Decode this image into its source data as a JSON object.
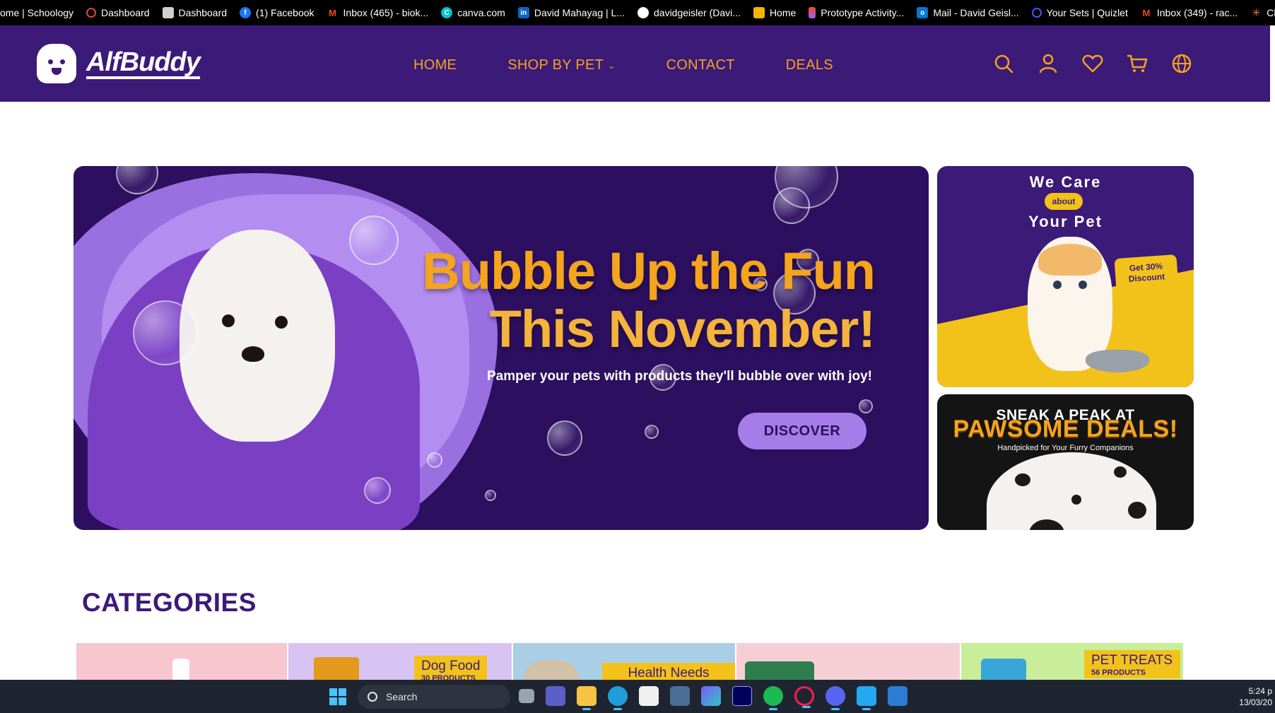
{
  "bookmarks": [
    {
      "label": "ome | Schoology",
      "icon": "schoology-icon",
      "color": "#000000"
    },
    {
      "label": "Dashboard",
      "icon": "dashboard-icon",
      "color": "#e0453a"
    },
    {
      "label": "Dashboard",
      "icon": "dashboard-icon",
      "color": "#d0d0d0"
    },
    {
      "label": "(1) Facebook",
      "icon": "facebook-icon",
      "color": "#1877f2"
    },
    {
      "label": "Inbox (465) - biok...",
      "icon": "gmail-icon",
      "color": "#ea4335"
    },
    {
      "label": "canva.com",
      "icon": "canva-icon",
      "color": "#00c4cc"
    },
    {
      "label": "David Mahayag | L...",
      "icon": "linkedin-icon",
      "color": "#0a66c2"
    },
    {
      "label": "davidgeisler (Davi...",
      "icon": "github-icon",
      "color": "#ffffff"
    },
    {
      "label": "Home",
      "icon": "home-icon",
      "color": "#f4b400"
    },
    {
      "label": "Prototype Activity...",
      "icon": "figma-icon",
      "color": "#f24e1e"
    },
    {
      "label": "Mail - David Geisl...",
      "icon": "outlook-icon",
      "color": "#0078d4"
    },
    {
      "label": "Your Sets | Quizlet",
      "icon": "quizlet-icon",
      "color": "#4255ff"
    },
    {
      "label": "Inbox (349) - rac...",
      "icon": "gmail-icon",
      "color": "#ea4335"
    },
    {
      "label": "Claude",
      "icon": "claude-icon",
      "color": "#d97757"
    }
  ],
  "header": {
    "logo_text": "AlfBuddy",
    "nav": {
      "home": "HOME",
      "shop_by_pet": "SHOP BY PET",
      "contact": "CONTACT",
      "deals": "DEALS"
    },
    "icons": [
      "search-icon",
      "account-icon",
      "wishlist-heart-icon",
      "cart-icon",
      "language-globe-icon"
    ],
    "brand_color": "#3c1a78",
    "accent_color": "#f4a41d"
  },
  "hero": {
    "title_line1": "Bubble Up the Fun",
    "title_line2": "This November!",
    "subtitle": "Pamper your pets with products they'll bubble over with joy!",
    "cta": "DISCOVER"
  },
  "promo_cat": {
    "line1": "We Care",
    "about": "about",
    "line2": "Your Pet",
    "badge_line1": "Get 30%",
    "badge_line2": "Discount"
  },
  "promo_deals": {
    "line1": "SNEAK A PEAK AT",
    "line2": "PAWSOME DEALS!",
    "line3": "Handpicked for Your Furry Companions"
  },
  "categories": {
    "heading": "CATEGORIES",
    "cards": [
      {
        "title": "",
        "count": "",
        "bg": "#f7c6cf"
      },
      {
        "title": "Dog Food",
        "count": "30 PRODUCTS",
        "bg": "#d7c3f1"
      },
      {
        "title": "Health Needs",
        "count": "",
        "bg": "#a9cfe6"
      },
      {
        "title": "",
        "count": "",
        "bg": "#f6cfd6"
      },
      {
        "title": "PET TREATS",
        "count": "56 PRODUCTS",
        "bg": "#c8ee9a"
      }
    ]
  },
  "taskbar": {
    "search_placeholder": "Search",
    "time": "5:24 p",
    "date": "13/03/20"
  }
}
